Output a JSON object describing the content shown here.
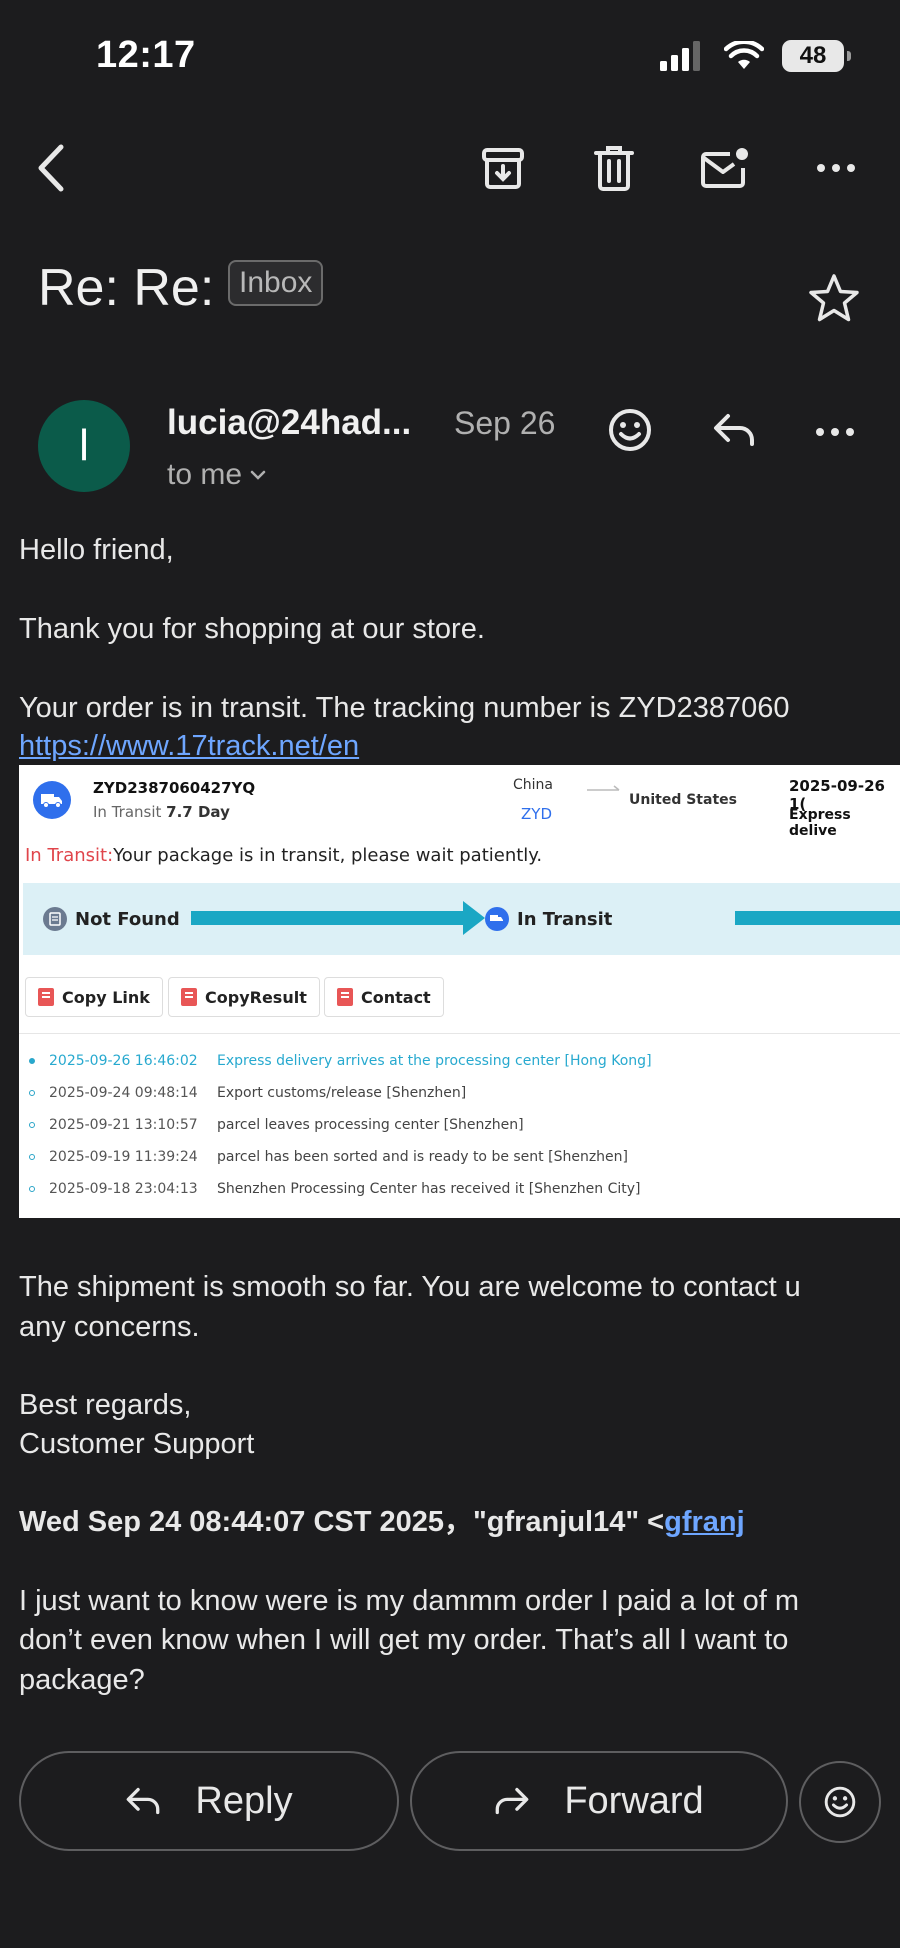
{
  "status_bar": {
    "time": "12:17",
    "battery": "48"
  },
  "email": {
    "subject": "Re: Re:",
    "label": "Inbox",
    "sender_initial": "l",
    "sender": "lucia@24had...",
    "date": "Sep 26",
    "recipient": "to me"
  },
  "body": {
    "greeting": "Hello friend,",
    "thanks": "Thank you for shopping at our store.",
    "transit_line": "Your order is in transit. The tracking number is ZYD2387060",
    "link": "https://www.17track.net/en",
    "smooth_line1": "The shipment is smooth so far. You are welcome to contact u",
    "smooth_line2": "any concerns.",
    "regards": "Best regards,",
    "signature": "Customer Support",
    "quote_header": "Wed Sep 24 08:44:07 CST 2025，\"gfranjul14\" <",
    "quote_email": "gfranj",
    "quote_line1": "I just want to know were is my dammm order I paid a lot of m",
    "quote_line2": "don’t even know when I will get my order. That’s all I want to",
    "quote_line3": "package?"
  },
  "tracking_card": {
    "number": "ZYD2387060427YQ",
    "status_prefix": "In Transit",
    "days": "7.7 Day",
    "origin": "China",
    "carrier": "ZYD",
    "destination": "United States",
    "latest_date": "2025-09-26 1(",
    "service": "Express delive",
    "status_label": "In Transit:",
    "status_text": "Your package is in transit, please wait patiently.",
    "steps": [
      "Not Found",
      "In Transit"
    ],
    "buttons": [
      "Copy Link",
      "CopyResult",
      "Contact"
    ],
    "events": [
      {
        "time": "2025-09-26 16:46:02",
        "text": "Express delivery arrives at the processing center [Hong Kong]"
      },
      {
        "time": "2025-09-24 09:48:14",
        "text": "Export customs/release [Shenzhen]"
      },
      {
        "time": "2025-09-21 13:10:57",
        "text": "parcel leaves processing center [Shenzhen]"
      },
      {
        "time": "2025-09-19 11:39:24",
        "text": "parcel has been sorted and is ready to be sent [Shenzhen]"
      },
      {
        "time": "2025-09-18 23:04:13",
        "text": "Shenzhen Processing Center has received it [Shenzhen City]"
      }
    ],
    "colors": {
      "accent_blue": "#2f6fec",
      "teal": "#1aa7c4",
      "red": "#e0454b"
    }
  },
  "actions": {
    "reply": "Reply",
    "forward": "Forward"
  },
  "theme": {
    "background": "#1c1c1e",
    "link": "#6ea6ff",
    "avatar": "#0b5b4a"
  }
}
